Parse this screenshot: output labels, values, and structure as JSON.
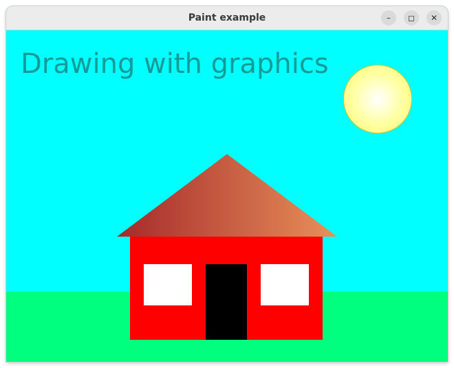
{
  "window": {
    "title": "Paint example",
    "controls": {
      "minimize": "–",
      "maximize": "◻",
      "close": "✕"
    }
  },
  "canvas": {
    "heading": "Drawing with graphics",
    "colors": {
      "sky": "#00ffff",
      "ground": "#00ff7f",
      "heading_text": "#149b98",
      "sun": "#ffff9e",
      "sun_outline": "#d9c61f",
      "roof_start": "#a52a2a",
      "roof_end": "#e8905a",
      "house_wall": "#ff0000",
      "house_window": "#ffffff",
      "door": "#000000"
    },
    "shapes": [
      "sun",
      "roof",
      "house-wall",
      "left-window",
      "door",
      "right-window"
    ]
  }
}
